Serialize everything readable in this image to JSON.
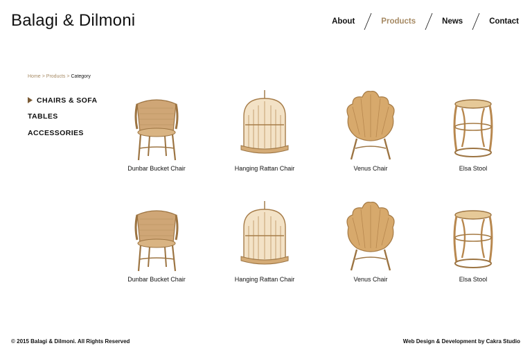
{
  "brand": {
    "name": "Balagi & Dilmoni"
  },
  "nav": {
    "items": [
      {
        "label": "About"
      },
      {
        "label": "Products"
      },
      {
        "label": "News"
      },
      {
        "label": "Contact"
      }
    ],
    "active": "Products",
    "separator_icon": "slash-divider"
  },
  "breadcrumb": {
    "home": "Home",
    "products": "Products",
    "current": "Category",
    "separator": ">"
  },
  "sidebar": {
    "categories": [
      {
        "label": "CHAIRS & SOFA",
        "icon": "triangle-right-icon"
      },
      {
        "label": "TABLES"
      },
      {
        "label": "ACCESSORIES"
      }
    ]
  },
  "products": [
    {
      "name": "Dunbar Bucket Chair"
    },
    {
      "name": "Hanging Rattan Chair"
    },
    {
      "name": "Venus Chair"
    },
    {
      "name": "Elsa Stool"
    },
    {
      "name": "Dunbar Bucket Chair"
    },
    {
      "name": "Hanging Rattan Chair"
    },
    {
      "name": "Venus Chair"
    },
    {
      "name": "Elsa Stool"
    }
  ],
  "footer": {
    "copyright": "© 2015 Balagi & Dilmoni. All Rights Reserved",
    "credit": "Web Design & Development by Cakra Studio"
  },
  "colors": {
    "accent": "#a68a64",
    "text": "#111111",
    "rattan": "#c9a06a",
    "rattan_dark": "#9c7442"
  }
}
